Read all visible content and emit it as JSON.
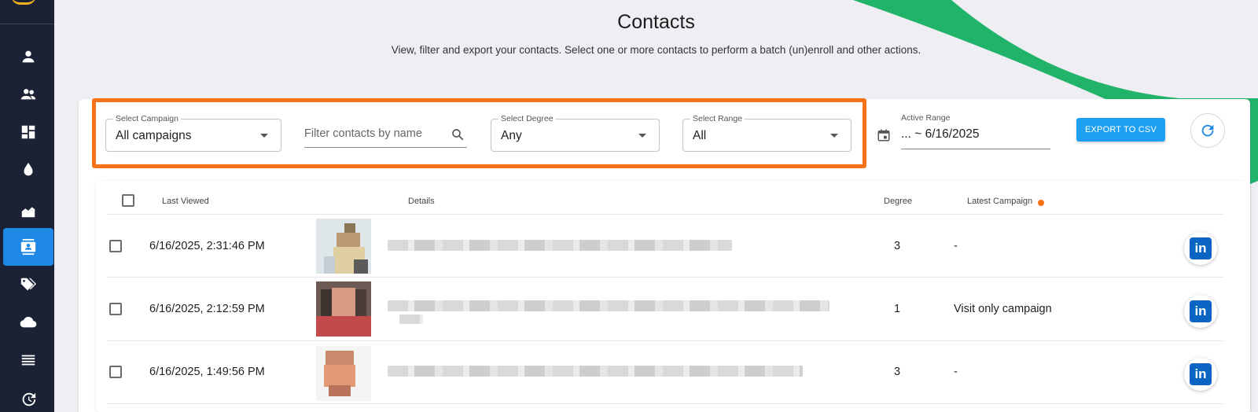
{
  "sidebar": {
    "items": [
      {
        "icon": "person-icon"
      },
      {
        "icon": "people-icon"
      },
      {
        "icon": "dashboard-icon"
      },
      {
        "icon": "drop-icon"
      },
      {
        "icon": "area-chart-icon"
      },
      {
        "icon": "contacts-icon",
        "active": true
      },
      {
        "icon": "tags-icon"
      },
      {
        "icon": "cloud-icon"
      },
      {
        "icon": "list-icon"
      },
      {
        "icon": "history-icon"
      }
    ]
  },
  "header": {
    "title": "Contacts",
    "subtitle": "View, filter and export your contacts. Select one or more contacts to perform a batch (un)enroll and other actions."
  },
  "filters": {
    "campaign": {
      "label": "Select Campaign",
      "value": "All campaigns"
    },
    "search": {
      "placeholder": "Filter contacts by name"
    },
    "degree": {
      "label": "Select Degree",
      "value": "Any"
    },
    "range": {
      "label": "Select Range",
      "value": "All"
    },
    "active_range": {
      "label": "Active Range",
      "value": "... ~ 6/16/2025"
    },
    "export_label": "EXPORT TO CSV"
  },
  "table": {
    "headers": {
      "last_viewed": "Last Viewed",
      "details": "Details",
      "degree": "Degree",
      "latest_campaign": "Latest Campaign"
    },
    "rows": [
      {
        "last_viewed": "6/16/2025, 2:31:46 PM",
        "degree": "3",
        "latest_campaign": "-"
      },
      {
        "last_viewed": "6/16/2025, 2:12:59 PM",
        "degree": "1",
        "latest_campaign": "Visit only campaign"
      },
      {
        "last_viewed": "6/16/2025, 1:49:56 PM",
        "degree": "3",
        "latest_campaign": "-"
      }
    ],
    "linkedin_label": "in"
  },
  "colors": {
    "sidebar": "#1b2236",
    "accent": "#1e88e5",
    "highlight": "#f97316",
    "stripe": "#22b36b",
    "linkedin": "#0a66c2"
  }
}
